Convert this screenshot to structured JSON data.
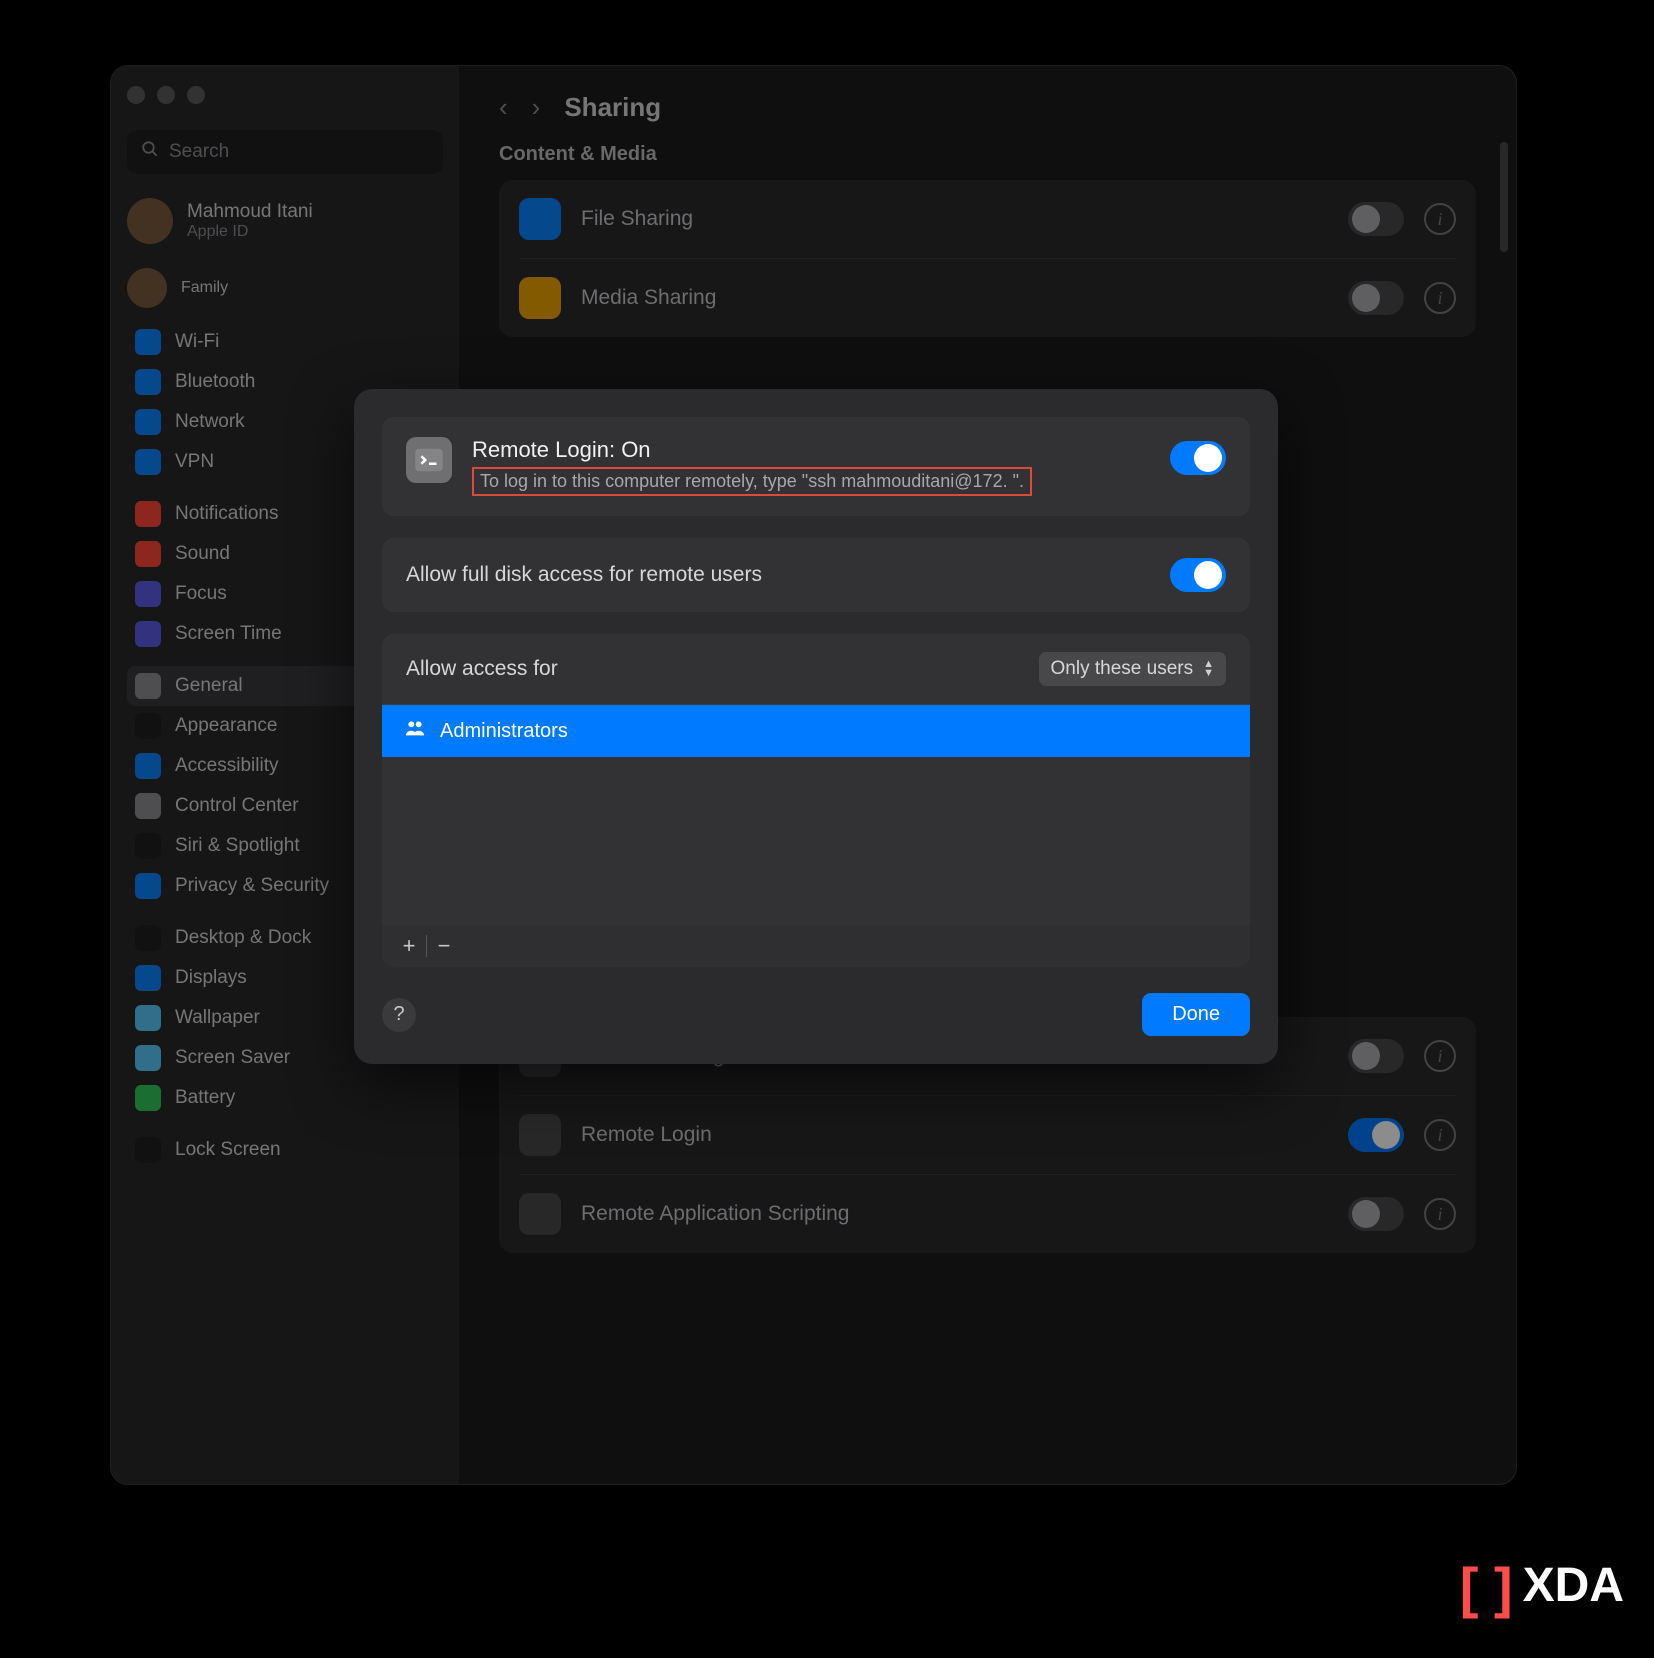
{
  "watermark": "XDA",
  "window": {
    "search_placeholder": "Search",
    "user": {
      "name": "Mahmoud Itani",
      "sub": "Apple ID"
    },
    "family": "Family",
    "sidebar_groups": [
      [
        {
          "label": "Wi-Fi",
          "color": "#0a84ff"
        },
        {
          "label": "Bluetooth",
          "color": "#0a84ff"
        },
        {
          "label": "Network",
          "color": "#0a84ff"
        },
        {
          "label": "VPN",
          "color": "#0a84ff"
        }
      ],
      [
        {
          "label": "Notifications",
          "color": "#ff453a"
        },
        {
          "label": "Sound",
          "color": "#ff453a"
        },
        {
          "label": "Focus",
          "color": "#5e5ce6"
        },
        {
          "label": "Screen Time",
          "color": "#5e5ce6"
        }
      ],
      [
        {
          "label": "General",
          "color": "#8e8e93",
          "selected": true
        },
        {
          "label": "Appearance",
          "color": "#202022"
        },
        {
          "label": "Accessibility",
          "color": "#0a84ff"
        },
        {
          "label": "Control Center",
          "color": "#8e8e93"
        },
        {
          "label": "Siri & Spotlight",
          "color": "#202022"
        },
        {
          "label": "Privacy & Security",
          "color": "#0a84ff"
        }
      ],
      [
        {
          "label": "Desktop & Dock",
          "color": "#202022"
        },
        {
          "label": "Displays",
          "color": "#0a84ff"
        },
        {
          "label": "Wallpaper",
          "color": "#5ac8fa"
        },
        {
          "label": "Screen Saver",
          "color": "#5ac8fa"
        },
        {
          "label": "Battery",
          "color": "#34c759"
        }
      ],
      [
        {
          "label": "Lock Screen",
          "color": "#202022"
        }
      ]
    ],
    "title": "Sharing",
    "section1": "Content & Media",
    "rows_top": [
      {
        "label": "File Sharing",
        "icon_bg": "#0a84ff"
      },
      {
        "label": "Media Sharing",
        "icon_bg": "#f0a500"
      }
    ],
    "rows_bottom": [
      {
        "label": "Remote Management",
        "icon_bg": "#4a4a4c"
      },
      {
        "label": "Remote Login",
        "icon_bg": "#4a4a4c",
        "on": true
      },
      {
        "label": "Remote Application Scripting",
        "icon_bg": "#4a4a4c"
      }
    ]
  },
  "modal": {
    "title": "Remote Login: On",
    "desc": "To log in to this computer remotely, type \"ssh mahmouditani@172.             \".",
    "main_toggle_on": true,
    "full_disk_label": "Allow full disk access for remote users",
    "full_disk_on": true,
    "access_label": "Allow access for",
    "access_value": "Only these users",
    "list": [
      {
        "label": "Administrators"
      }
    ],
    "done": "Done"
  }
}
